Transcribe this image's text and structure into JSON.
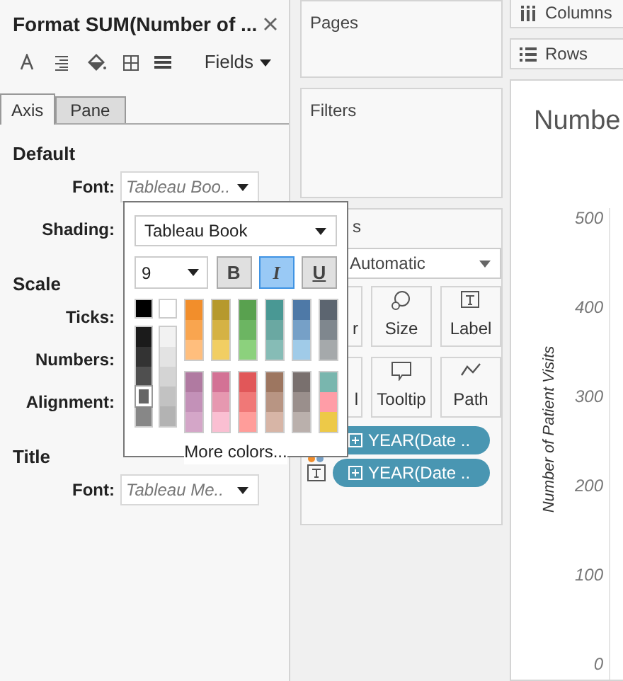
{
  "format_pane": {
    "title": "Format SUM(Number of ...",
    "fields_menu": "Fields",
    "tabs": [
      {
        "label": "Axis",
        "selected": true
      },
      {
        "label": "Pane",
        "selected": false
      }
    ],
    "sections": [
      {
        "heading": "Default",
        "rows": [
          {
            "label": "Font:",
            "value": "Tableau Boo.."
          },
          {
            "label": "Shading:"
          }
        ]
      },
      {
        "heading": "Scale",
        "rows": [
          {
            "label": "Ticks:"
          },
          {
            "label": "Numbers:"
          },
          {
            "label": "Alignment:"
          }
        ]
      },
      {
        "heading": "Title",
        "rows": [
          {
            "label": "Font:",
            "value": "Tableau Me.."
          }
        ]
      }
    ]
  },
  "font_popup": {
    "font": "Tableau Book",
    "size": "9",
    "styles": [
      {
        "label": "B",
        "selected": false
      },
      {
        "label": "I",
        "selected": true
      },
      {
        "label": "U",
        "selected": false
      }
    ],
    "black": {
      "color": "#000000",
      "selected": false
    },
    "white": {
      "color": "#ffffff",
      "selected": false
    },
    "dark_grays": [
      {
        "color": "#1b1b1b",
        "selected": false
      },
      {
        "color": "#333333",
        "selected": false
      },
      {
        "color": "#4f4f4f",
        "selected": false
      },
      {
        "color": "#666666",
        "selected": true
      },
      {
        "color": "#878787",
        "selected": false
      }
    ],
    "light_grays": [
      {
        "color": "#f2f2f2",
        "selected": false
      },
      {
        "color": "#e3e3e3",
        "selected": false
      },
      {
        "color": "#d4d4d4",
        "selected": false
      },
      {
        "color": "#c2c2c2",
        "selected": false
      },
      {
        "color": "#b3b3b3",
        "selected": false
      }
    ],
    "palette_rows": [
      [
        [
          {
            "color": "#f28e2b"
          },
          {
            "color": "#f9a54f"
          },
          {
            "color": "#ffbe7d"
          }
        ],
        [
          {
            "color": "#b6992d"
          },
          {
            "color": "#d5b244"
          },
          {
            "color": "#f1ce63"
          }
        ],
        [
          {
            "color": "#59a14f"
          },
          {
            "color": "#6cb562"
          },
          {
            "color": "#8cd17d"
          }
        ],
        [
          {
            "color": "#499894"
          },
          {
            "color": "#6aa8a2"
          },
          {
            "color": "#86bcb6"
          }
        ],
        [
          {
            "color": "#4e79a7"
          },
          {
            "color": "#76a0c7"
          },
          {
            "color": "#a0cbe8"
          }
        ],
        [
          {
            "color": "#5c6570"
          },
          {
            "color": "#7f878e"
          },
          {
            "color": "#a5a9ab"
          }
        ]
      ],
      [
        [
          {
            "color": "#b07aa1"
          },
          {
            "color": "#c391b8"
          },
          {
            "color": "#d4a6c8"
          }
        ],
        [
          {
            "color": "#d37295"
          },
          {
            "color": "#e698b0"
          },
          {
            "color": "#fabfd2"
          }
        ],
        [
          {
            "color": "#e15759"
          },
          {
            "color": "#f07877"
          },
          {
            "color": "#ff9d9a"
          }
        ],
        [
          {
            "color": "#9d7660"
          },
          {
            "color": "#b89583"
          },
          {
            "color": "#d7b5a6"
          }
        ],
        [
          {
            "color": "#79706e"
          },
          {
            "color": "#9a8f8c"
          },
          {
            "color": "#bab0ac"
          }
        ],
        [
          {
            "color": "#79b6ae"
          },
          {
            "color": "#ff9da7"
          },
          {
            "color": "#edc948"
          }
        ]
      ]
    ],
    "more": "More colors..."
  },
  "shelves": {
    "pages": "Pages",
    "filters": "Filters",
    "columns": "Columns",
    "rows": "Rows"
  },
  "marks": {
    "title": "s",
    "mark_type": "Automatic",
    "buttons": [
      {
        "kind": "color",
        "label": "r"
      },
      {
        "kind": "size",
        "label": "Size"
      },
      {
        "kind": "label",
        "label": "Label"
      },
      {
        "kind": "detail",
        "label": "l"
      },
      {
        "kind": "tooltip",
        "label": "Tooltip"
      },
      {
        "kind": "path",
        "label": "Path"
      }
    ],
    "pills": [
      {
        "kind": "color",
        "text": "YEAR(Date .."
      },
      {
        "kind": "label",
        "text": "YEAR(Date .."
      }
    ]
  },
  "view": {
    "title": "Numbe",
    "axis_title": "Number of Patient Visits",
    "ticks": [
      "500",
      "400",
      "300",
      "200",
      "100",
      "0"
    ]
  }
}
